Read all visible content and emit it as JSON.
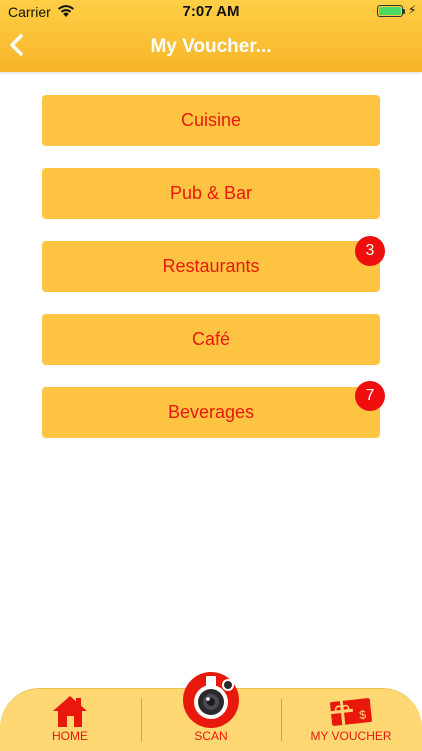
{
  "status_bar": {
    "carrier": "Carrier",
    "time": "7:07 AM"
  },
  "nav": {
    "title": "My Voucher..."
  },
  "categories": [
    {
      "label": "Cuisine"
    },
    {
      "label": "Pub & Bar"
    },
    {
      "label": "Restaurants",
      "badge": "3"
    },
    {
      "label": "Café"
    },
    {
      "label": "Beverages",
      "badge": "7"
    }
  ],
  "tabbar": {
    "home_label": "HOME",
    "scan_label": "SCAN",
    "voucher_label": "MY VOUCHER"
  },
  "colors": {
    "header": "#f7b52a",
    "button_bg": "#ffc542",
    "button_text": "#e8190c",
    "badge": "#ef0d0d",
    "tabbar_bg": "#ffd873"
  }
}
